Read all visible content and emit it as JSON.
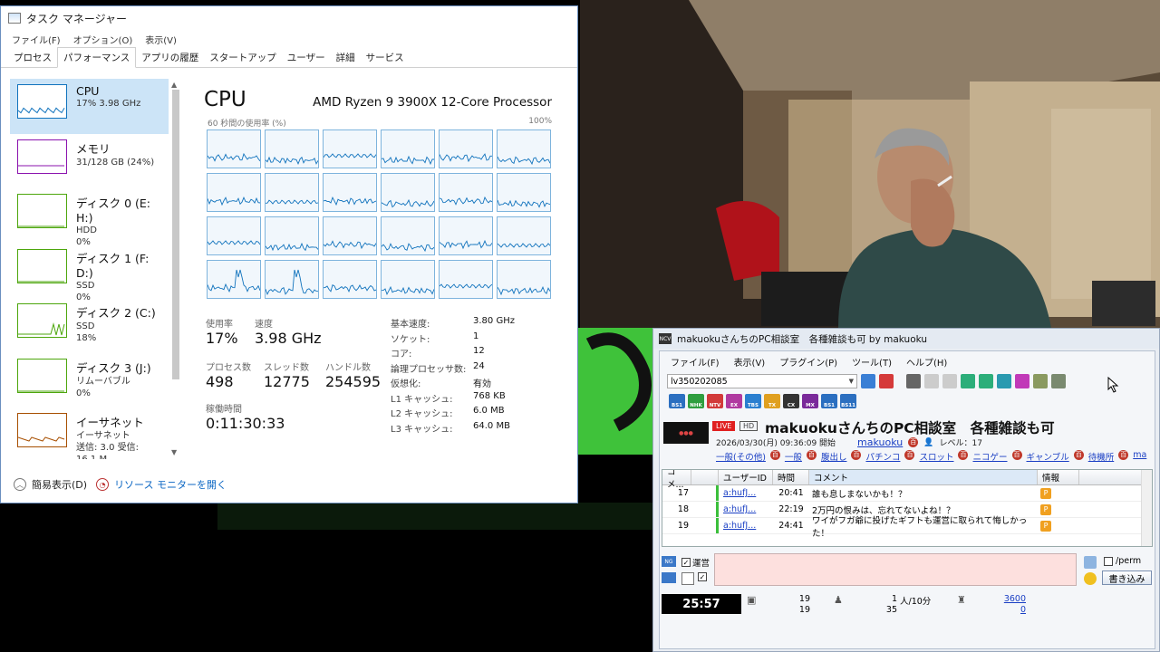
{
  "task_manager": {
    "title": "タスク マネージャー",
    "menu": [
      "ファイル(F)",
      "オプション(O)",
      "表示(V)"
    ],
    "tabs": [
      "プロセス",
      "パフォーマンス",
      "アプリの履歴",
      "スタートアップ",
      "ユーザー",
      "詳細",
      "サービス"
    ],
    "active_tab": "パフォーマンス",
    "sidebar": [
      {
        "name": "CPU",
        "line2": "17% 3.98 GHz",
        "line3": "",
        "color": "#1173bd"
      },
      {
        "name": "メモリ",
        "line2": "31/128 GB (24%)",
        "line3": "",
        "color": "#8b12ae"
      },
      {
        "name": "ディスク 0 (E: H:)",
        "line2": "HDD",
        "line3": "0%",
        "color": "#4da60c"
      },
      {
        "name": "ディスク 1 (F: D:)",
        "line2": "SSD",
        "line3": "0%",
        "color": "#4da60c"
      },
      {
        "name": "ディスク 2 (C:)",
        "line2": "SSD",
        "line3": "18%",
        "color": "#4da60c"
      },
      {
        "name": "ディスク 3 (J:)",
        "line2": "リムーバブル",
        "line3": "0%",
        "color": "#4da60c"
      },
      {
        "name": "イーサネット",
        "line2": "イーサネット",
        "line3": "送信: 3.0 受信: 16.1 M",
        "color": "#a74f01"
      }
    ],
    "main": {
      "title": "CPU",
      "processor": "AMD Ryzen 9 3900X 12-Core Processor",
      "graph_label": "60 秒間の使用率 (%)",
      "graph_max": "100%",
      "usage_label": "使用率",
      "usage": "17%",
      "speed_label": "速度",
      "speed": "3.98 GHz",
      "processes_label": "プロセス数",
      "processes": "498",
      "threads_label": "スレッド数",
      "threads": "12775",
      "handles_label": "ハンドル数",
      "handles": "254595",
      "uptime_label": "稼働時間",
      "uptime": "0:11:30:33",
      "specs": [
        {
          "k": "基本速度:",
          "v": "3.80 GHz"
        },
        {
          "k": "ソケット:",
          "v": "1"
        },
        {
          "k": "コア:",
          "v": "12"
        },
        {
          "k": "論理プロセッサ数:",
          "v": "24"
        },
        {
          "k": "仮想化:",
          "v": "有効"
        },
        {
          "k": "L1 キャッシュ:",
          "v": "768 KB"
        },
        {
          "k": "L2 キャッシュ:",
          "v": "6.0 MB"
        },
        {
          "k": "L3 キャッシュ:",
          "v": "64.0 MB"
        }
      ]
    },
    "footer": {
      "simple": "簡易表示(D)",
      "resmon": "リソース モニターを開く"
    }
  },
  "ncv": {
    "title": "makuokuさんちのPC相談室　各種雑談も可 by makuoku",
    "menu": [
      "ファイル(F)",
      "表示(V)",
      "プラグイン(P)",
      "ツール(T)",
      "ヘルプ(H)"
    ],
    "lv": "lv350202085",
    "channels": [
      {
        "label": "BS1",
        "color": "#2b6fc0"
      },
      {
        "label": "NHK",
        "color": "#2f9e3f"
      },
      {
        "label": "NTV",
        "color": "#d23a3a"
      },
      {
        "label": "EX",
        "color": "#b03aa0"
      },
      {
        "label": "TBS",
        "color": "#2a7fd0"
      },
      {
        "label": "TX",
        "color": "#e0a020"
      },
      {
        "label": "CX",
        "color": "#333333"
      },
      {
        "label": "MX",
        "color": "#7a2a9a"
      },
      {
        "label": "BS1",
        "color": "#2b6fc0"
      },
      {
        "label": "BS11",
        "color": "#2b6fc0"
      }
    ],
    "live": "LIVE",
    "hd": "HD",
    "program_title": "makuokuさんちのPC相談室　各種雑談も可",
    "datetime": "2026/03/30(月) 09:36:09 開始",
    "owner": "makuoku",
    "level": "レベル：17",
    "tags": [
      "一般(その他)",
      "一般",
      "腹出し",
      "パチンコ",
      "スロット",
      "ニコゲー",
      "ギャンブル",
      "待機所",
      "ma"
    ],
    "table_headers": [
      "コメ...",
      "ユーザーID",
      "時間",
      "コメント",
      "情報"
    ],
    "comments": [
      {
        "no": "17",
        "user": "a:hufJ...",
        "time": "20:41",
        "text": "誰も息しまないかも！？",
        "info": "P"
      },
      {
        "no": "18",
        "user": "a:hufJ...",
        "time": "22:19",
        "text": "2万円の恨みは、忘れてないよね！？",
        "info": "P"
      },
      {
        "no": "19",
        "user": "a:hufJ...",
        "time": "24:41",
        "text": "ワイがフガ爺に投げたギフトも運営に取られて悔しかった！",
        "info": "P"
      }
    ],
    "unei_label": "運営",
    "perm_label": "/perm",
    "write_label": "書き込み",
    "timer": "25:57",
    "stats": {
      "comments": "19",
      "comments2": "19",
      "viewers": "1",
      "viewers_unit": "人/10分",
      "viewers2": "35",
      "points": "3600",
      "points2": "0"
    }
  }
}
